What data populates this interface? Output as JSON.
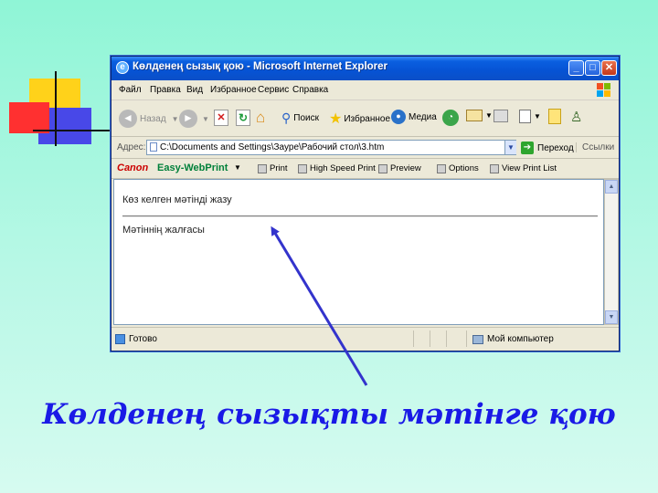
{
  "window": {
    "title": "Көлденең сызық қою - Microsoft Internet Explorer",
    "min_label": "_",
    "max_label": "□",
    "close_label": "✕"
  },
  "menu": {
    "items": [
      "Файл",
      "Правка",
      "Вид",
      "Избранное",
      "Сервис",
      "Справка"
    ]
  },
  "toolbar": {
    "back_label": "Назад",
    "search_label": "Поиск",
    "favorites_label": "Избранное",
    "media_label": "Медиа"
  },
  "address": {
    "label": "Адрес:",
    "value": "C:\\Documents and Settings\\Зауре\\Рабочий стол\\3.htm",
    "go_label": "Переход",
    "links_label": "Ссылки"
  },
  "canon": {
    "brand": "Canon",
    "product": "Easy-WebPrint",
    "print_label": "Print",
    "high_speed_label": "High Speed Print",
    "preview_label": "Preview",
    "options_label": "Options",
    "view_list_label": "View Print List"
  },
  "page": {
    "heading_text": "Көз келген мәтінді жазу",
    "body_text": "Мәтіннің жалғасы"
  },
  "status": {
    "left": "Готово",
    "right": "Мой компьютер"
  },
  "caption": "Көлденең сызықты мәтінге қою",
  "colors": {
    "caption": "#1a1ae6",
    "arrow": "#3333cc",
    "title_bar": "#0653d4"
  }
}
